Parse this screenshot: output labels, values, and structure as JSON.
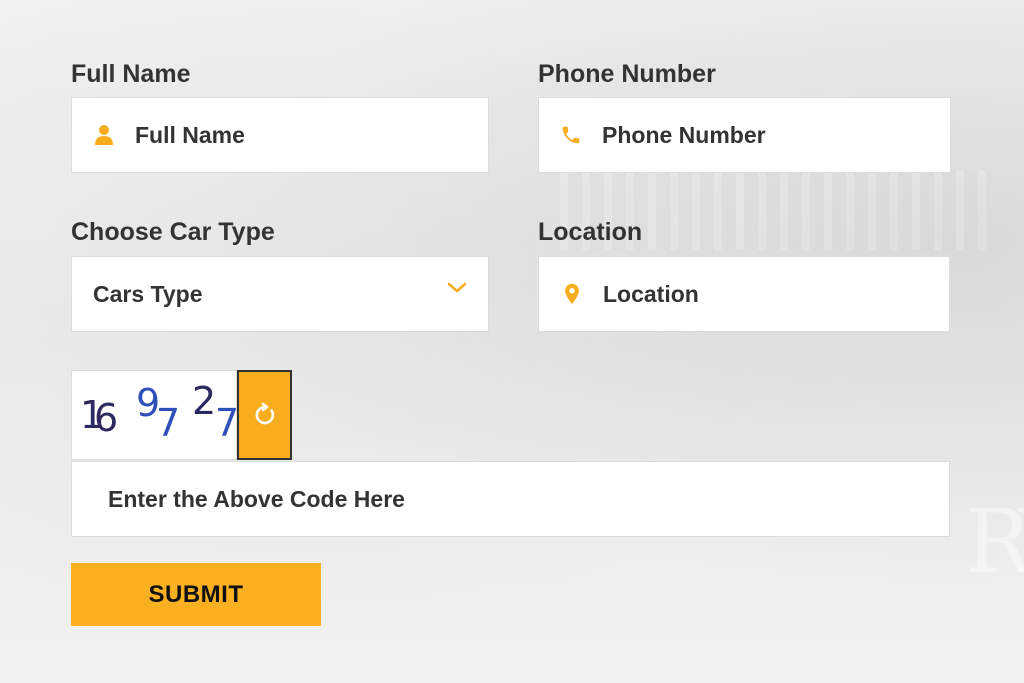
{
  "form": {
    "full_name": {
      "label": "Full Name",
      "placeholder": "Full Name"
    },
    "phone": {
      "label": "Phone Number",
      "placeholder": "Phone Number"
    },
    "car_type": {
      "label": "Choose Car Type",
      "selected": "Cars Type"
    },
    "location": {
      "label": "Location",
      "placeholder": "Location"
    },
    "captcha": {
      "characters": [
        "1",
        "6",
        "9",
        "7",
        "2",
        "7"
      ],
      "refresh_icon": "refresh-icon"
    },
    "captcha_input": {
      "placeholder": "Enter the Above Code Here"
    },
    "submit_label": "SUBMIT"
  },
  "icons": {
    "full_name": "user-icon",
    "phone": "phone-icon",
    "location": "map-pin-icon",
    "dropdown": "chevron-down-icon"
  },
  "colors": {
    "accent": "#fbb021",
    "text": "#333333",
    "captcha_dark": "#2c2a5e",
    "captcha_blue": "#2f4fb8",
    "background": "#efefef"
  }
}
